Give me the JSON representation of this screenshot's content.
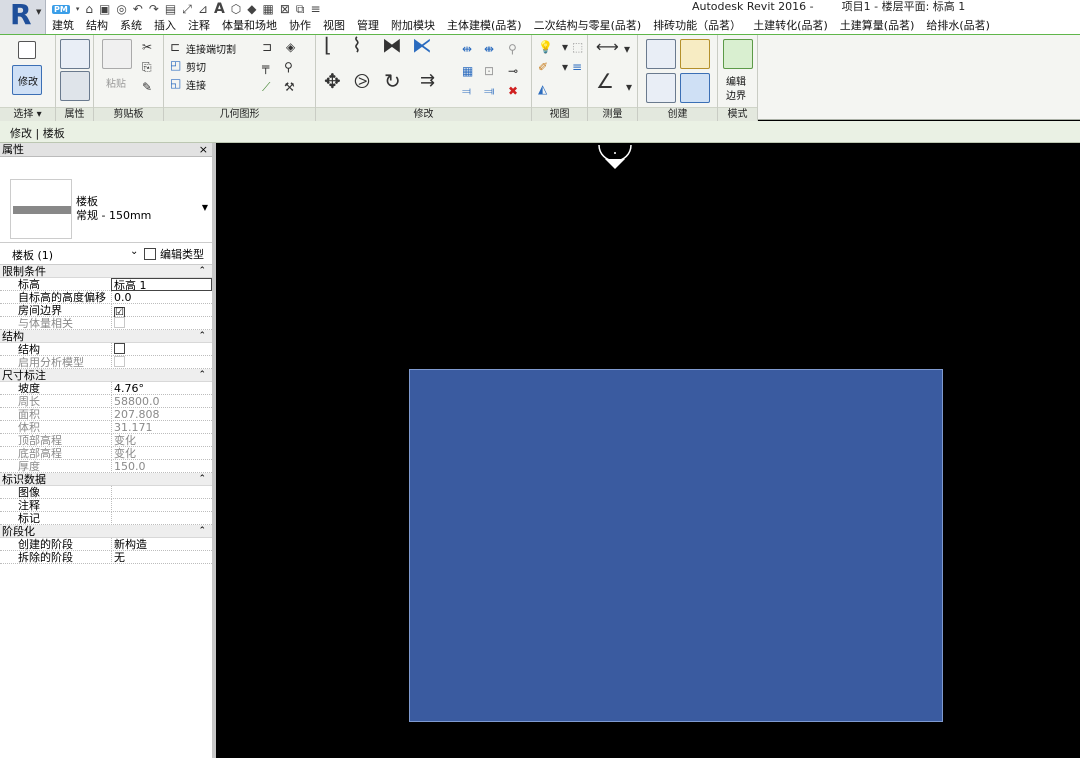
{
  "titlebar": {
    "qat_pm": "PM",
    "app_title": "Autodesk Revit 2016 -",
    "doc_title": "项目1 - 楼层平面: 标高 1"
  },
  "tabs": [
    "建筑",
    "结构",
    "系统",
    "插入",
    "注释",
    "体量和场地",
    "协作",
    "视图",
    "管理",
    "附加模块",
    "主体建模(品茗)",
    "二次结构与零星(品茗)",
    "排砖功能（品茗）",
    "土建转化(品茗)",
    "土建算量(品茗)",
    "给排水(品茗)"
  ],
  "ribbon": {
    "modify_label": "修改",
    "paste_label": "粘贴",
    "cut_join": "连接端切割",
    "cut": "剪切",
    "join": "连接",
    "edit_boundary_line1": "编辑",
    "edit_boundary_line2": "边界",
    "groups": {
      "select": "选择 ▾",
      "properties": "属性",
      "clipboard": "剪贴板",
      "geometry": "几何图形",
      "modify": "修改",
      "view": "视图",
      "measure": "测量",
      "create": "创建",
      "mode": "模式"
    }
  },
  "contextbar": {
    "text": "修改 | 楼板"
  },
  "properties": {
    "header": "属性",
    "close": "×",
    "type_line1": "楼板",
    "type_line2": "常规 - 150mm",
    "instance_label": "楼板 (1)",
    "edit_type": "编辑类型",
    "sections": {
      "constraints": "限制条件",
      "structure": "结构",
      "dimensions": "尺寸标注",
      "identity": "标识数据",
      "phasing": "阶段化"
    },
    "rows": {
      "level": {
        "k": "标高",
        "v": "标高 1"
      },
      "offset": {
        "k": "自标高的高度偏移",
        "v": "0.0"
      },
      "room_bounding": {
        "k": "房间边界",
        "v": "☑"
      },
      "mass_related": {
        "k": "与体量相关",
        "v": ""
      },
      "structural": {
        "k": "结构",
        "v": ""
      },
      "analytical": {
        "k": "启用分析模型",
        "v": ""
      },
      "slope": {
        "k": "坡度",
        "v": "4.76°"
      },
      "perimeter": {
        "k": "周长",
        "v": "58800.0"
      },
      "area": {
        "k": "面积",
        "v": "207.808"
      },
      "volume": {
        "k": "体积",
        "v": "31.171"
      },
      "top_elev": {
        "k": "顶部高程",
        "v": "变化"
      },
      "bottom_elev": {
        "k": "底部高程",
        "v": "变化"
      },
      "thickness": {
        "k": "厚度",
        "v": "150.0"
      },
      "image": {
        "k": "图像",
        "v": ""
      },
      "comments": {
        "k": "注释",
        "v": ""
      },
      "mark": {
        "k": "标记",
        "v": ""
      },
      "phase_created": {
        "k": "创建的阶段",
        "v": "新构造"
      },
      "phase_demolished": {
        "k": "拆除的阶段",
        "v": "无"
      }
    }
  },
  "colors": {
    "floor_fill": "#3a5ba0",
    "canvas_bg": "#000000",
    "ribbon_accent": "#5fb64a"
  }
}
